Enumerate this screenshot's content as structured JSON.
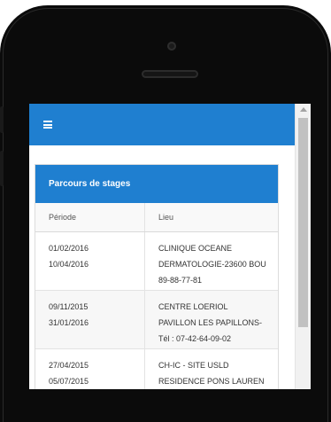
{
  "navbar": {
    "menu_icon": "hamburger-menu-icon",
    "color": "#1f7fd0"
  },
  "panel": {
    "title": "Parcours de stages",
    "columns": [
      "Période",
      "Lieu"
    ],
    "rows": [
      {
        "dates": [
          "01/02/2016",
          "10/04/2016"
        ],
        "lieu": [
          "CLINIQUE OCEANE",
          "DERMATOLOGIE-23600 BOU",
          "89-88-77-81"
        ]
      },
      {
        "dates": [
          "09/11/2015",
          "31/01/2016"
        ],
        "lieu": [
          "CENTRE LOERIOL",
          "PAVILLON LES PAPILLONS-",
          "Tél : 07-42-64-09-02"
        ]
      },
      {
        "dates": [
          "27/04/2015",
          "05/07/2015"
        ],
        "lieu": [
          "CH-IC - SITE USLD",
          "RESIDENCE PONS LAUREN"
        ]
      }
    ]
  }
}
